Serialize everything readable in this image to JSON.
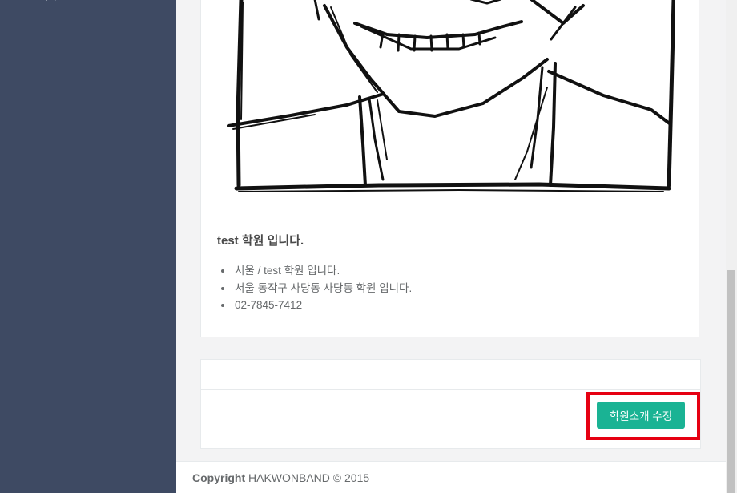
{
  "intro": {
    "title": "test 학원 입니다.",
    "items": [
      "서울 / test 학원 입니다.",
      "서울 동작구 사당동 사당동 학원 입니다.",
      "02-7845-7412"
    ]
  },
  "actions": {
    "edit_label": "학원소개 수정"
  },
  "footer": {
    "copyright_label": "Copyright",
    "company": "HAKWONBAND © 2015"
  },
  "colors": {
    "sidebar": "#3e4a63",
    "primary_button": "#1ab394",
    "highlight": "#e60012"
  }
}
